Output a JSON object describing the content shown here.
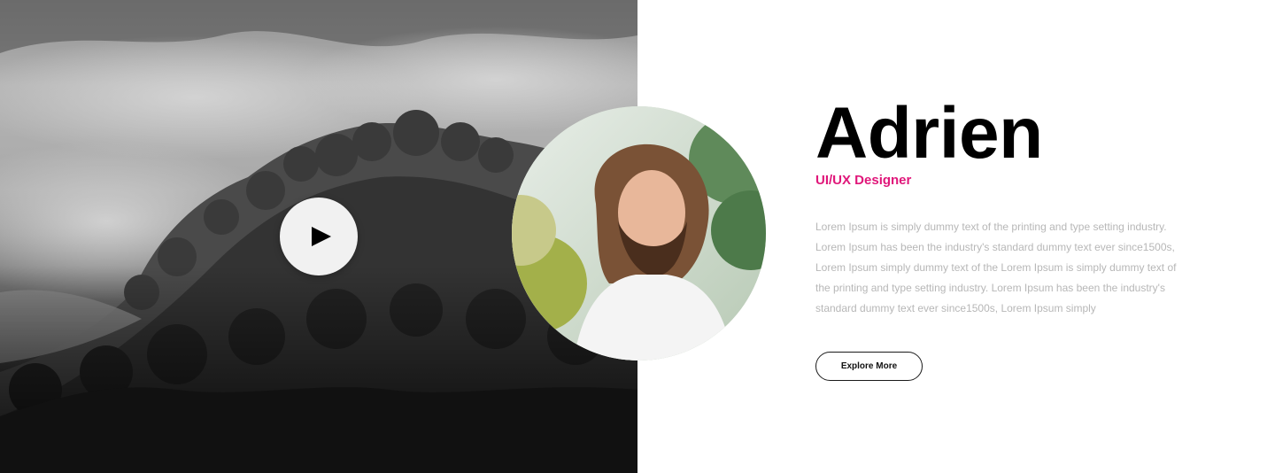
{
  "profile": {
    "name": "Adrien",
    "role": "UI/UX Designer",
    "bio": "Lorem Ipsum is simply dummy text of the printing and type setting industry. Lorem Ipsum has been the industry's standard dummy text ever since1500s, Lorem Ipsum simply dummy text of the Lorem Ipsum is simply dummy text of the printing and type setting industry. Lorem Ipsum has been the industry's standard dummy text ever since1500s, Lorem Ipsum simply",
    "cta_label": "Explore More"
  },
  "media": {
    "play_icon": "play-icon",
    "background_image": "grayscale-misty-forest",
    "avatar_image": "bearded-man-portrait"
  },
  "colors": {
    "accent": "#e0177a",
    "heading": "#000000",
    "body_text": "#b7b7b7",
    "background": "#ffffff"
  }
}
